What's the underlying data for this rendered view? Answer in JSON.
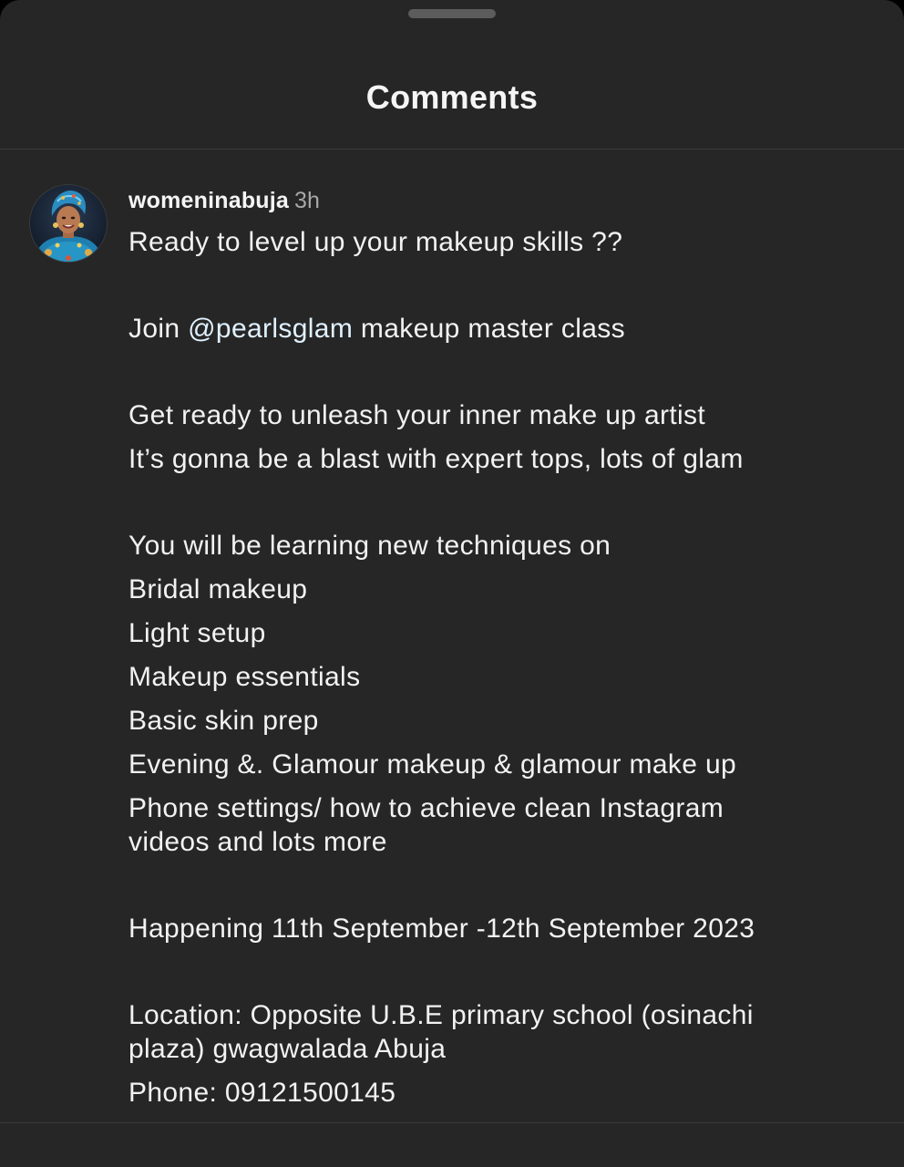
{
  "header": {
    "title": "Comments"
  },
  "comment": {
    "avatar_icon": "profile-photo-avatar",
    "username": "womeninabuja",
    "time": "3h",
    "lines": {
      "l1": "Ready to level up your makeup skills ??",
      "l2_prefix": "Join ",
      "l2_mention": "@pearlsglam",
      "l2_suffix": " makeup master class",
      "l3": "Get ready to unleash your inner make up artist",
      "l4": "It’s gonna be a blast with expert tops, lots of glam",
      "l5": "You will be learning new techniques on",
      "l6": "Bridal makeup",
      "l7": "Light setup",
      "l8": "Makeup essentials",
      "l9": "Basic skin prep",
      "l10": "Evening &. Glamour makeup & glamour make up",
      "l11a": "Phone settings/ how to achieve clean Instagram",
      "l11b": "videos and lots more",
      "l12": "Happening 11th September -12th September 2023",
      "l13a": "Location: Opposite U.B.E primary school (osinachi",
      "l13b": "plaza) gwagwalada Abuja",
      "l14": "Phone: 09121500145"
    }
  },
  "colors": {
    "sheet_background": "#262626",
    "text_primary": "#f2f2f2",
    "text_secondary": "#a8a8a8",
    "mention": "#e0f1ff",
    "divider": "#3a3a3a"
  }
}
